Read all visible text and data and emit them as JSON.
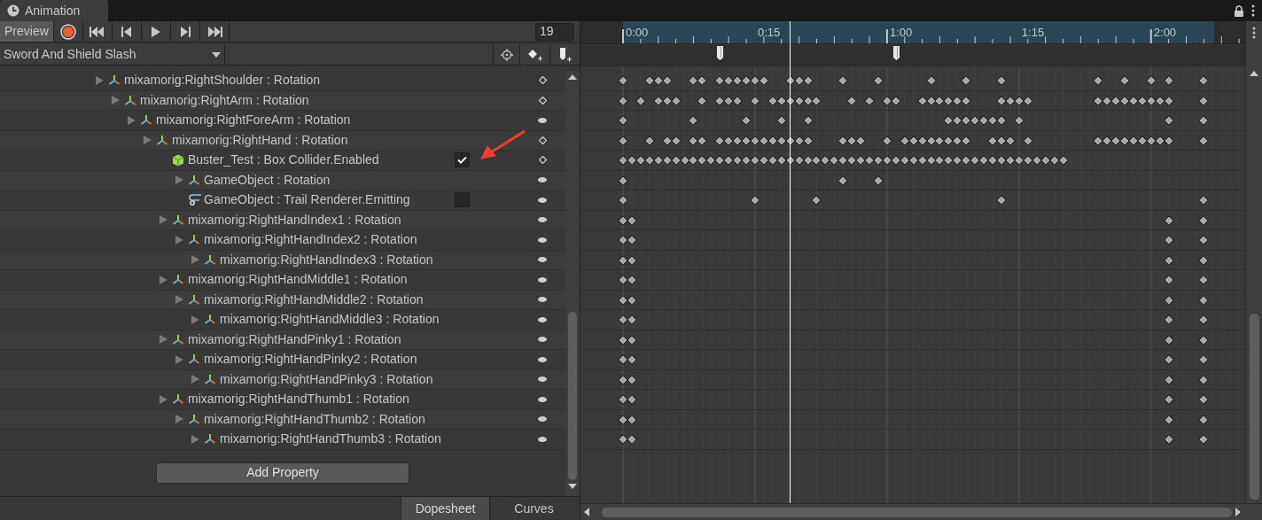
{
  "window": {
    "title": "Animation"
  },
  "toolbar": {
    "preview_label": "Preview",
    "frame": "19"
  },
  "clip": {
    "name": "Sword And Shield Slash"
  },
  "timeline": {
    "labels": [
      "0:00",
      "0:15",
      "1:00",
      "1:15",
      "2:00"
    ]
  },
  "properties": [
    {
      "name": "mixamorig:RightShoulder : Rotation",
      "kind": "rotation",
      "key_at_frame": true,
      "children": [
        {
          "name": "mixamorig:RightArm : Rotation",
          "kind": "rotation",
          "key_at_frame": true,
          "children": [
            {
              "name": "mixamorig:RightForeArm : Rotation",
              "kind": "rotation",
              "key_at_frame": false,
              "children": [
                {
                  "name": "mixamorig:RightHand : Rotation",
                  "kind": "rotation",
                  "key_at_frame": true,
                  "children": [
                    {
                      "name": "Buster_Test : Box Collider.Enabled",
                      "kind": "box_collider",
                      "checked": true,
                      "key_at_frame": true,
                      "children": [
                        {
                          "name": "GameObject : Rotation",
                          "kind": "rotation",
                          "key_at_frame": false
                        },
                        {
                          "name": "GameObject : Trail Renderer.Emitting",
                          "kind": "trail_renderer",
                          "checked": false,
                          "key_at_frame": false
                        }
                      ]
                    },
                    {
                      "name": "mixamorig:RightHandIndex1 : Rotation",
                      "kind": "rotation",
                      "key_at_frame": false,
                      "children": [
                        {
                          "name": "mixamorig:RightHandIndex2 : Rotation",
                          "kind": "rotation",
                          "key_at_frame": false,
                          "children": [
                            {
                              "name": "mixamorig:RightHandIndex3 : Rotation",
                              "kind": "rotation",
                              "key_at_frame": false
                            }
                          ]
                        }
                      ]
                    },
                    {
                      "name": "mixamorig:RightHandMiddle1 : Rotation",
                      "kind": "rotation",
                      "key_at_frame": false,
                      "children": [
                        {
                          "name": "mixamorig:RightHandMiddle2 : Rotation",
                          "kind": "rotation",
                          "key_at_frame": false,
                          "children": [
                            {
                              "name": "mixamorig:RightHandMiddle3 : Rotation",
                              "kind": "rotation",
                              "key_at_frame": false
                            }
                          ]
                        }
                      ]
                    },
                    {
                      "name": "mixamorig:RightHandPinky1 : Rotation",
                      "kind": "rotation",
                      "key_at_frame": false,
                      "children": [
                        {
                          "name": "mixamorig:RightHandPinky2 : Rotation",
                          "kind": "rotation",
                          "key_at_frame": false,
                          "children": [
                            {
                              "name": "mixamorig:RightHandPinky3 : Rotation",
                              "kind": "rotation",
                              "key_at_frame": false
                            }
                          ]
                        }
                      ]
                    },
                    {
                      "name": "mixamorig:RightHandThumb1 : Rotation",
                      "kind": "rotation",
                      "key_at_frame": false,
                      "children": [
                        {
                          "name": "mixamorig:RightHandThumb2 : Rotation",
                          "kind": "rotation",
                          "key_at_frame": false,
                          "children": [
                            {
                              "name": "mixamorig:RightHandThumb3 : Rotation",
                              "kind": "rotation",
                              "key_at_frame": false
                            }
                          ]
                        }
                      ]
                    }
                  ]
                }
              ]
            }
          ]
        }
      ]
    }
  ],
  "add_property_button": "Add Property",
  "view_tabs": [
    {
      "label": "Dopesheet",
      "selected": true
    },
    {
      "label": "Curves",
      "selected": false
    }
  ]
}
